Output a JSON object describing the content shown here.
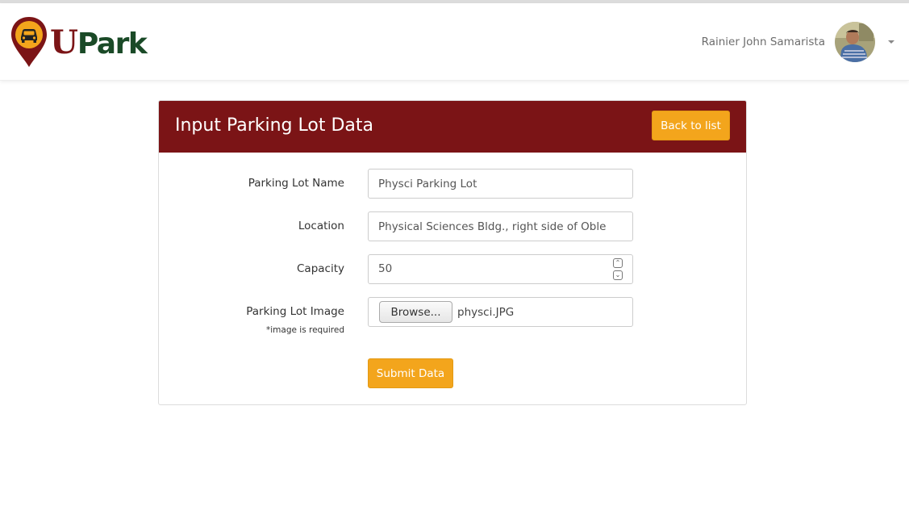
{
  "header": {
    "logo_text_u": "U",
    "logo_text_park": "Park",
    "user_name": "Rainier John Samarista"
  },
  "card": {
    "title": "Input Parking Lot Data",
    "back_label": "Back to list"
  },
  "form": {
    "name_label": "Parking Lot Name",
    "name_value": "Physci Parking Lot",
    "location_label": "Location",
    "location_value": "Physical Sciences Bldg., right side of Oble",
    "capacity_label": "Capacity",
    "capacity_value": "50",
    "image_label": "Parking Lot Image",
    "image_note": "*image is required",
    "browse_label": "Browse...",
    "file_name": "physci.JPG",
    "submit_label": "Submit Data"
  },
  "colors": {
    "brand_maroon": "#7b1416",
    "accent_orange": "#f3a51c",
    "brand_green": "#1a4a27"
  },
  "icons": {
    "logo": "car-location-pin-icon",
    "caret": "caret-down-icon",
    "spin_up": "chevron-up-icon",
    "spin_down": "chevron-down-icon"
  }
}
